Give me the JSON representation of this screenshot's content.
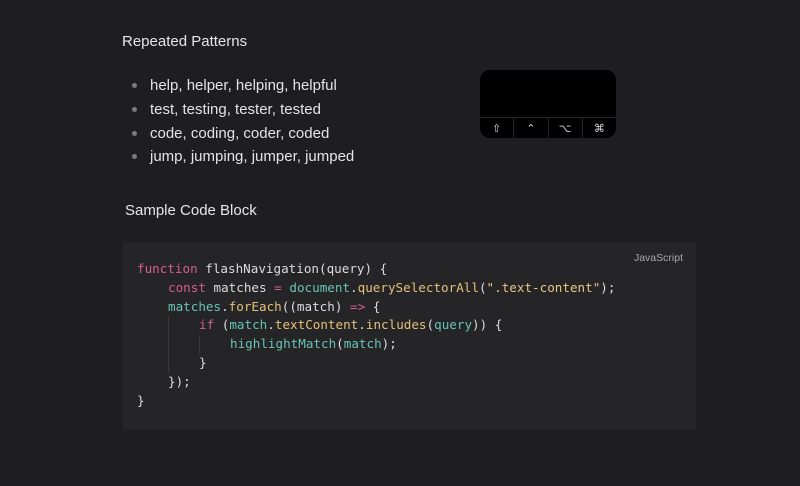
{
  "sections": {
    "patterns_title": "Repeated Patterns",
    "code_title": "Sample Code Block"
  },
  "patterns": [
    "help, helper, helping, helpful",
    "test, testing, tester, tested",
    "code, coding, coder, coded",
    "jump, jumping, jumper, jumped"
  ],
  "keys": [
    {
      "glyph": "⇧",
      "icon": "shift-icon"
    },
    {
      "glyph": "⌃",
      "icon": "control-icon"
    },
    {
      "glyph": "⌥",
      "icon": "option-icon"
    },
    {
      "glyph": "⌘",
      "icon": "command-icon"
    }
  ],
  "code": {
    "language": "JavaScript",
    "colors": {
      "keyword": "#d45f86",
      "function": "#e4c07a",
      "variable": "#67c2b4",
      "string": "#e8c785",
      "plain": "#dcdcde"
    },
    "lines": [
      {
        "indent": 0,
        "tokens": [
          [
            "kw",
            "function"
          ],
          [
            "plain",
            " flashNavigation(query) {"
          ]
        ]
      },
      {
        "indent": 1,
        "tokens": [
          [
            "kw",
            "const"
          ],
          [
            "plain",
            " matches "
          ],
          [
            "op",
            "="
          ],
          [
            "plain",
            " "
          ],
          [
            "var",
            "document"
          ],
          [
            "plain",
            "."
          ],
          [
            "fn",
            "querySelectorAll"
          ],
          [
            "plain",
            "("
          ],
          [
            "str",
            "\".text-content\""
          ],
          [
            "plain",
            ");"
          ]
        ]
      },
      {
        "indent": 1,
        "tokens": [
          [
            "var",
            "matches"
          ],
          [
            "plain",
            "."
          ],
          [
            "fn",
            "forEach"
          ],
          [
            "plain",
            "((match) "
          ],
          [
            "op",
            "=>"
          ],
          [
            "plain",
            " {"
          ]
        ]
      },
      {
        "indent": 2,
        "tokens": [
          [
            "kw",
            "if"
          ],
          [
            "plain",
            " ("
          ],
          [
            "var",
            "match"
          ],
          [
            "plain",
            "."
          ],
          [
            "fn",
            "textContent"
          ],
          [
            "plain",
            "."
          ],
          [
            "fn",
            "includes"
          ],
          [
            "plain",
            "("
          ],
          [
            "var",
            "query"
          ],
          [
            "plain",
            ")) {"
          ]
        ]
      },
      {
        "indent": 3,
        "tokens": [
          [
            "var",
            "highlightMatch"
          ],
          [
            "plain",
            "("
          ],
          [
            "var",
            "match"
          ],
          [
            "plain",
            ");"
          ]
        ]
      },
      {
        "indent": 2,
        "tokens": [
          [
            "plain",
            "}"
          ]
        ]
      },
      {
        "indent": 1,
        "tokens": [
          [
            "plain",
            "});"
          ]
        ]
      },
      {
        "indent": 0,
        "tokens": [
          [
            "plain",
            "}"
          ]
        ]
      }
    ]
  }
}
